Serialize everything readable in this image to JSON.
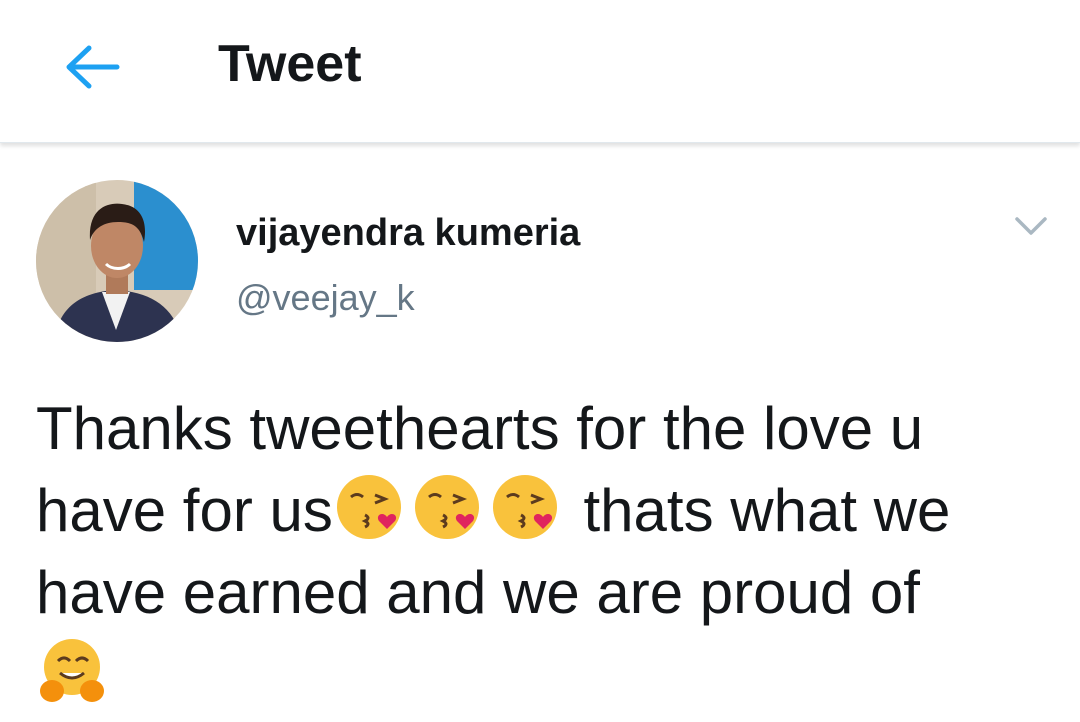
{
  "header": {
    "title": "Tweet",
    "back_icon": "arrow-left-icon",
    "accent_color": "#1da1f2"
  },
  "author": {
    "name": "vijayendra kumeria",
    "handle": "@veejay_k",
    "more_icon": "chevron-down-icon"
  },
  "tweet": {
    "line_1": "Thanks tweethearts for the love u",
    "line_2_start": "have for us",
    "line_2_end": " thats what we",
    "line_3": "have earned and we are proud of",
    "emojis": [
      "face-blowing-a-kiss-emoji",
      "face-blowing-a-kiss-emoji",
      "face-blowing-a-kiss-emoji",
      "hugging-face-emoji"
    ]
  }
}
